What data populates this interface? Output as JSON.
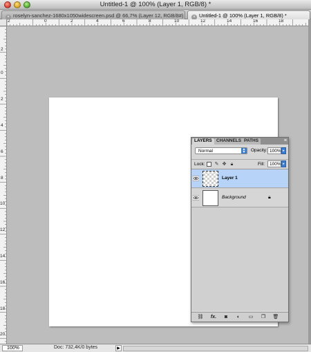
{
  "window": {
    "title": "Untitled-1 @ 100% (Layer 1, RGB/8) *"
  },
  "tabs": [
    {
      "label": "roselyn-sanchez-1680x1050widescreen.psd @ 66,7% (Layer 12, RGB/8#)",
      "active": false
    },
    {
      "label": "Untitled-1 @ 100% (Layer 1, RGB/8) *",
      "active": true
    }
  ],
  "ruler": {
    "horizontal_labels": [
      "2",
      "0",
      "2",
      "4",
      "6",
      "8",
      "10",
      "12",
      "14",
      "16",
      "18"
    ],
    "vertical_labels": [
      "2",
      "0",
      "2",
      "4",
      "6",
      "8",
      "10",
      "12",
      "14",
      "16",
      "18",
      "20"
    ]
  },
  "status": {
    "zoom": "100%",
    "doc": "Doc: 732,4K/0 bytes",
    "menu_arrow": "▶"
  },
  "layers_panel": {
    "tabs": [
      "LAYERS",
      "CHANNELS",
      "PATHS"
    ],
    "menu_icon": "≡",
    "blend_mode": "Normal",
    "opacity_label": "Opacity:",
    "opacity_value": "100%",
    "lock_label": "Lock:",
    "fill_label": "Fill:",
    "fill_value": "100%",
    "layers": [
      {
        "name": "Layer 1",
        "selected": true,
        "visible": true,
        "locked": false
      },
      {
        "name": "Background",
        "selected": false,
        "visible": true,
        "locked": true
      }
    ],
    "footer_icons": [
      "link-icon",
      "fx-icon",
      "mask-icon",
      "adjustment-icon",
      "group-folder-icon",
      "new-layer-icon",
      "trash-icon"
    ],
    "fx_label": "fx."
  },
  "colors": {
    "selected_layer": "#b7d4f8",
    "canvas": "#ffffff",
    "workspace": "#bdbdbd"
  }
}
